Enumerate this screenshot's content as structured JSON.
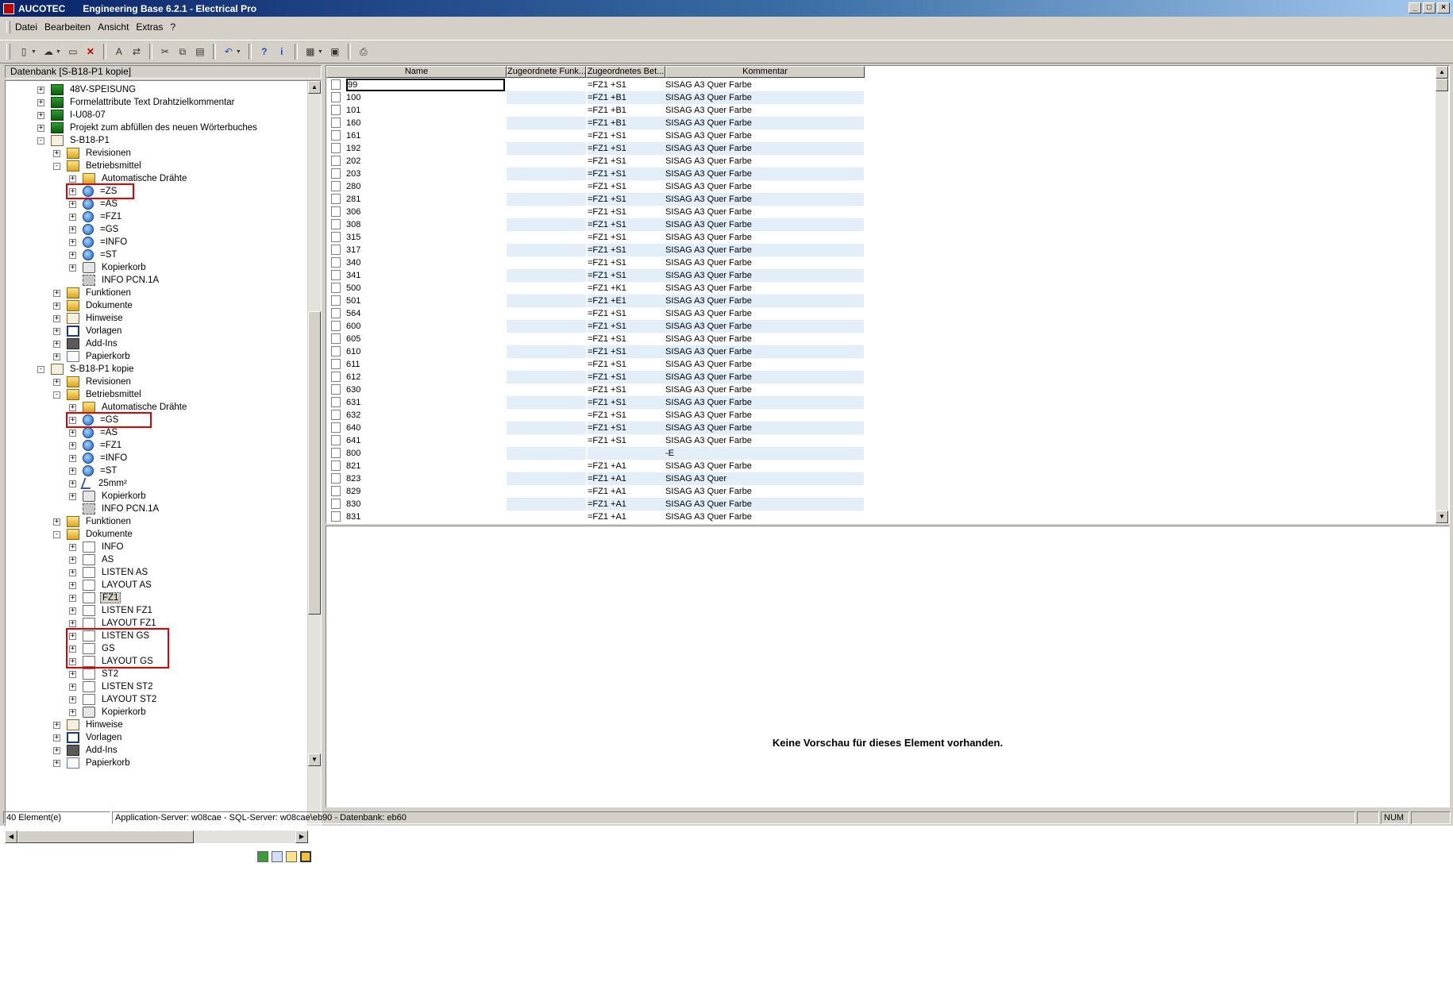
{
  "window": {
    "app_name": "AUCOTEC",
    "title": "Engineering Base 6.2.1 - Electrical Pro",
    "buttons": [
      "_",
      "□",
      "×"
    ]
  },
  "menu": [
    "Datei",
    "Bearbeiten",
    "Ansicht",
    "Extras",
    "?"
  ],
  "toolbar_icons": [
    "new-icon",
    "open-dropdown-icon",
    "open-folder-icon",
    "delete-icon",
    "find-icon",
    "replace-icon",
    "cut-icon",
    "copy-icon",
    "paste-icon",
    "undo-icon",
    "help-icon",
    "info-icon",
    "view-icon",
    "view2-icon",
    "print-icon"
  ],
  "left": {
    "header": "Datenbank [S-B18-P1 kopie]",
    "tree": [
      {
        "level": 0,
        "exp": "+",
        "icon": "project",
        "label": "48V-SPEISUNG"
      },
      {
        "level": 0,
        "exp": "+",
        "icon": "project",
        "label": "Formelattribute Text Drahtzielkommentar"
      },
      {
        "level": 0,
        "exp": "+",
        "icon": "project",
        "label": "I-U08-07"
      },
      {
        "level": 0,
        "exp": "+",
        "icon": "project",
        "label": "Projekt zum abfüllen des neuen Wörterbuches"
      },
      {
        "level": 0,
        "exp": "-",
        "icon": "book",
        "label": "S-B18-P1"
      },
      {
        "level": 1,
        "exp": "+",
        "icon": "folder",
        "label": "Revisionen"
      },
      {
        "level": 1,
        "exp": "-",
        "icon": "folder",
        "label": "Betriebsmittel"
      },
      {
        "level": 2,
        "exp": "+",
        "icon": "folder",
        "label": "Automatische Drähte"
      },
      {
        "level": 2,
        "exp": "+",
        "icon": "globe",
        "label": "=ZS"
      },
      {
        "level": 2,
        "exp": "+",
        "icon": "globe",
        "label": "=AS"
      },
      {
        "level": 2,
        "exp": "+",
        "icon": "globe",
        "label": "=FZ1"
      },
      {
        "level": 2,
        "exp": "+",
        "icon": "globe",
        "label": "=GS"
      },
      {
        "level": 2,
        "exp": "+",
        "icon": "globe",
        "label": "=INFO"
      },
      {
        "level": 2,
        "exp": "+",
        "icon": "globe",
        "label": "=ST"
      },
      {
        "level": 2,
        "exp": "+",
        "icon": "basket",
        "label": "Kopierkorb"
      },
      {
        "level": 2,
        "exp": "",
        "icon": "gear",
        "label": "INFO PCN.1A"
      },
      {
        "level": 1,
        "exp": "+",
        "icon": "folder",
        "label": "Funktionen"
      },
      {
        "level": 1,
        "exp": "+",
        "icon": "folder",
        "label": "Dokumente"
      },
      {
        "level": 1,
        "exp": "+",
        "icon": "book",
        "label": "Hinweise"
      },
      {
        "level": 1,
        "exp": "+",
        "icon": "vorlagen",
        "label": "Vorlagen"
      },
      {
        "level": 1,
        "exp": "+",
        "icon": "addins",
        "label": "Add-Ins"
      },
      {
        "level": 1,
        "exp": "+",
        "icon": "paper",
        "label": "Papierkorb"
      },
      {
        "level": 0,
        "exp": "-",
        "icon": "book",
        "label": "S-B18-P1 kopie"
      },
      {
        "level": 1,
        "exp": "+",
        "icon": "folder",
        "label": "Revisionen"
      },
      {
        "level": 1,
        "exp": "-",
        "icon": "folder",
        "label": "Betriebsmittel"
      },
      {
        "level": 2,
        "exp": "+",
        "icon": "folder",
        "label": "Automatische Drähte"
      },
      {
        "level": 2,
        "exp": "+",
        "icon": "globe",
        "label": "=GS"
      },
      {
        "level": 2,
        "exp": "+",
        "icon": "globe",
        "label": "=AS"
      },
      {
        "level": 2,
        "exp": "+",
        "icon": "globe",
        "label": "=FZ1"
      },
      {
        "level": 2,
        "exp": "+",
        "icon": "globe",
        "label": "=INFO"
      },
      {
        "level": 2,
        "exp": "+",
        "icon": "globe",
        "label": "=ST"
      },
      {
        "level": 2,
        "exp": "+",
        "icon": "wire",
        "label": "25mm²"
      },
      {
        "level": 2,
        "exp": "+",
        "icon": "basket",
        "label": "Kopierkorb"
      },
      {
        "level": 2,
        "exp": "",
        "icon": "gear",
        "label": "INFO PCN.1A"
      },
      {
        "level": 1,
        "exp": "+",
        "icon": "folder",
        "label": "Funktionen"
      },
      {
        "level": 1,
        "exp": "-",
        "icon": "folder",
        "label": "Dokumente"
      },
      {
        "level": 2,
        "exp": "+",
        "icon": "doc",
        "label": "INFO"
      },
      {
        "level": 2,
        "exp": "+",
        "icon": "doc",
        "label": "AS"
      },
      {
        "level": 2,
        "exp": "+",
        "icon": "doc",
        "label": "LISTEN AS"
      },
      {
        "level": 2,
        "exp": "+",
        "icon": "doc",
        "label": "LAYOUT AS"
      },
      {
        "level": 2,
        "exp": "+",
        "icon": "doc",
        "label": "FZ1",
        "selected": true
      },
      {
        "level": 2,
        "exp": "+",
        "icon": "doc",
        "label": "LISTEN FZ1"
      },
      {
        "level": 2,
        "exp": "+",
        "icon": "doc",
        "label": "LAYOUT FZ1"
      },
      {
        "level": 2,
        "exp": "+",
        "icon": "doc",
        "label": "LISTEN GS"
      },
      {
        "level": 2,
        "exp": "+",
        "icon": "doc",
        "label": "GS"
      },
      {
        "level": 2,
        "exp": "+",
        "icon": "doc",
        "label": "LAYOUT GS"
      },
      {
        "level": 2,
        "exp": "+",
        "icon": "doc",
        "label": "ST2"
      },
      {
        "level": 2,
        "exp": "+",
        "icon": "doc",
        "label": "LISTEN ST2"
      },
      {
        "level": 2,
        "exp": "+",
        "icon": "doc",
        "label": "LAYOUT ST2"
      },
      {
        "level": 2,
        "exp": "+",
        "icon": "basket",
        "label": "Kopierkorb"
      },
      {
        "level": 1,
        "exp": "+",
        "icon": "book",
        "label": "Hinweise"
      },
      {
        "level": 1,
        "exp": "+",
        "icon": "vorlagen",
        "label": "Vorlagen"
      },
      {
        "level": 1,
        "exp": "+",
        "icon": "addins",
        "label": "Add-Ins"
      },
      {
        "level": 1,
        "exp": "+",
        "icon": "paper",
        "label": "Papierkorb"
      }
    ]
  },
  "grid": {
    "columns": [
      "Name",
      "Zugeordnete Funk...",
      "Zugeordnetes Bet...",
      "Kommentar"
    ],
    "rows": [
      {
        "name": "99",
        "funk": "",
        "bet": "=FZ1 +S1",
        "kommentar": "SISAG A3 Quer Farbe"
      },
      {
        "name": "100",
        "funk": "",
        "bet": "=FZ1 +B1",
        "kommentar": "SISAG A3 Quer Farbe"
      },
      {
        "name": "101",
        "funk": "",
        "bet": "=FZ1 +B1",
        "kommentar": "SISAG A3 Quer Farbe"
      },
      {
        "name": "160",
        "funk": "",
        "bet": "=FZ1 +B1",
        "kommentar": "SISAG A3 Quer Farbe"
      },
      {
        "name": "161",
        "funk": "",
        "bet": "=FZ1 +S1",
        "kommentar": "SISAG A3 Quer Farbe"
      },
      {
        "name": "192",
        "funk": "",
        "bet": "=FZ1 +S1",
        "kommentar": "SISAG A3 Quer Farbe"
      },
      {
        "name": "202",
        "funk": "",
        "bet": "=FZ1 +S1",
        "kommentar": "SISAG A3 Quer Farbe"
      },
      {
        "name": "203",
        "funk": "",
        "bet": "=FZ1 +S1",
        "kommentar": "SISAG A3 Quer Farbe"
      },
      {
        "name": "280",
        "funk": "",
        "bet": "=FZ1 +S1",
        "kommentar": "SISAG A3 Quer Farbe"
      },
      {
        "name": "281",
        "funk": "",
        "bet": "=FZ1 +S1",
        "kommentar": "SISAG A3 Quer Farbe"
      },
      {
        "name": "306",
        "funk": "",
        "bet": "=FZ1 +S1",
        "kommentar": "SISAG A3 Quer Farbe"
      },
      {
        "name": "308",
        "funk": "",
        "bet": "=FZ1 +S1",
        "kommentar": "SISAG A3 Quer Farbe"
      },
      {
        "name": "315",
        "funk": "",
        "bet": "=FZ1 +S1",
        "kommentar": "SISAG A3 Quer Farbe"
      },
      {
        "name": "317",
        "funk": "",
        "bet": "=FZ1 +S1",
        "kommentar": "SISAG A3 Quer Farbe"
      },
      {
        "name": "340",
        "funk": "",
        "bet": "=FZ1 +S1",
        "kommentar": "SISAG A3 Quer Farbe"
      },
      {
        "name": "341",
        "funk": "",
        "bet": "=FZ1 +S1",
        "kommentar": "SISAG A3 Quer Farbe"
      },
      {
        "name": "500",
        "funk": "",
        "bet": "=FZ1 +K1",
        "kommentar": "SISAG A3 Quer Farbe"
      },
      {
        "name": "501",
        "funk": "",
        "bet": "=FZ1 +E1",
        "kommentar": "SISAG A3 Quer Farbe"
      },
      {
        "name": "564",
        "funk": "",
        "bet": "=FZ1 +S1",
        "kommentar": "SISAG A3 Quer Farbe"
      },
      {
        "name": "600",
        "funk": "",
        "bet": "=FZ1 +S1",
        "kommentar": "SISAG A3 Quer Farbe"
      },
      {
        "name": "605",
        "funk": "",
        "bet": "=FZ1 +S1",
        "kommentar": "SISAG A3 Quer Farbe"
      },
      {
        "name": "610",
        "funk": "",
        "bet": "=FZ1 +S1",
        "kommentar": "SISAG A3 Quer Farbe"
      },
      {
        "name": "611",
        "funk": "",
        "bet": "=FZ1 +S1",
        "kommentar": "SISAG A3 Quer Farbe"
      },
      {
        "name": "612",
        "funk": "",
        "bet": "=FZ1 +S1",
        "kommentar": "SISAG A3 Quer Farbe"
      },
      {
        "name": "630",
        "funk": "",
        "bet": "=FZ1 +S1",
        "kommentar": "SISAG A3 Quer Farbe"
      },
      {
        "name": "631",
        "funk": "",
        "bet": "=FZ1 +S1",
        "kommentar": "SISAG A3 Quer Farbe"
      },
      {
        "name": "632",
        "funk": "",
        "bet": "=FZ1 +S1",
        "kommentar": "SISAG A3 Quer Farbe"
      },
      {
        "name": "640",
        "funk": "",
        "bet": "=FZ1 +S1",
        "kommentar": "SISAG A3 Quer Farbe"
      },
      {
        "name": "641",
        "funk": "",
        "bet": "=FZ1 +S1",
        "kommentar": "SISAG A3 Quer Farbe"
      },
      {
        "name": "800",
        "funk": "",
        "bet": "",
        "kommentar": "-E"
      },
      {
        "name": "821",
        "funk": "",
        "bet": "=FZ1 +A1",
        "kommentar": "SISAG A3 Quer Farbe"
      },
      {
        "name": "823",
        "funk": "",
        "bet": "=FZ1 +A1",
        "kommentar": "SISAG A3 Quer"
      },
      {
        "name": "829",
        "funk": "",
        "bet": "=FZ1 +A1",
        "kommentar": "SISAG A3 Quer Farbe"
      },
      {
        "name": "830",
        "funk": "",
        "bet": "=FZ1 +A1",
        "kommentar": "SISAG A3 Quer Farbe"
      },
      {
        "name": "831",
        "funk": "",
        "bet": "=FZ1 +A1",
        "kommentar": "SISAG A3 Quer Farbe"
      }
    ]
  },
  "preview": {
    "message": "Keine Vorschau für dieses Element vorhanden."
  },
  "status": {
    "count": "40 Element(e)",
    "server": "Application-Server: w08cae - SQL-Server: w08cae\\eb90 - Datenbank: eb60",
    "num": "NUM"
  },
  "colors": {
    "highlight_box": "#e00000",
    "alt_row": "#e2eefa",
    "chrome": "#d4d0c8",
    "title_start": "#0a246a"
  }
}
